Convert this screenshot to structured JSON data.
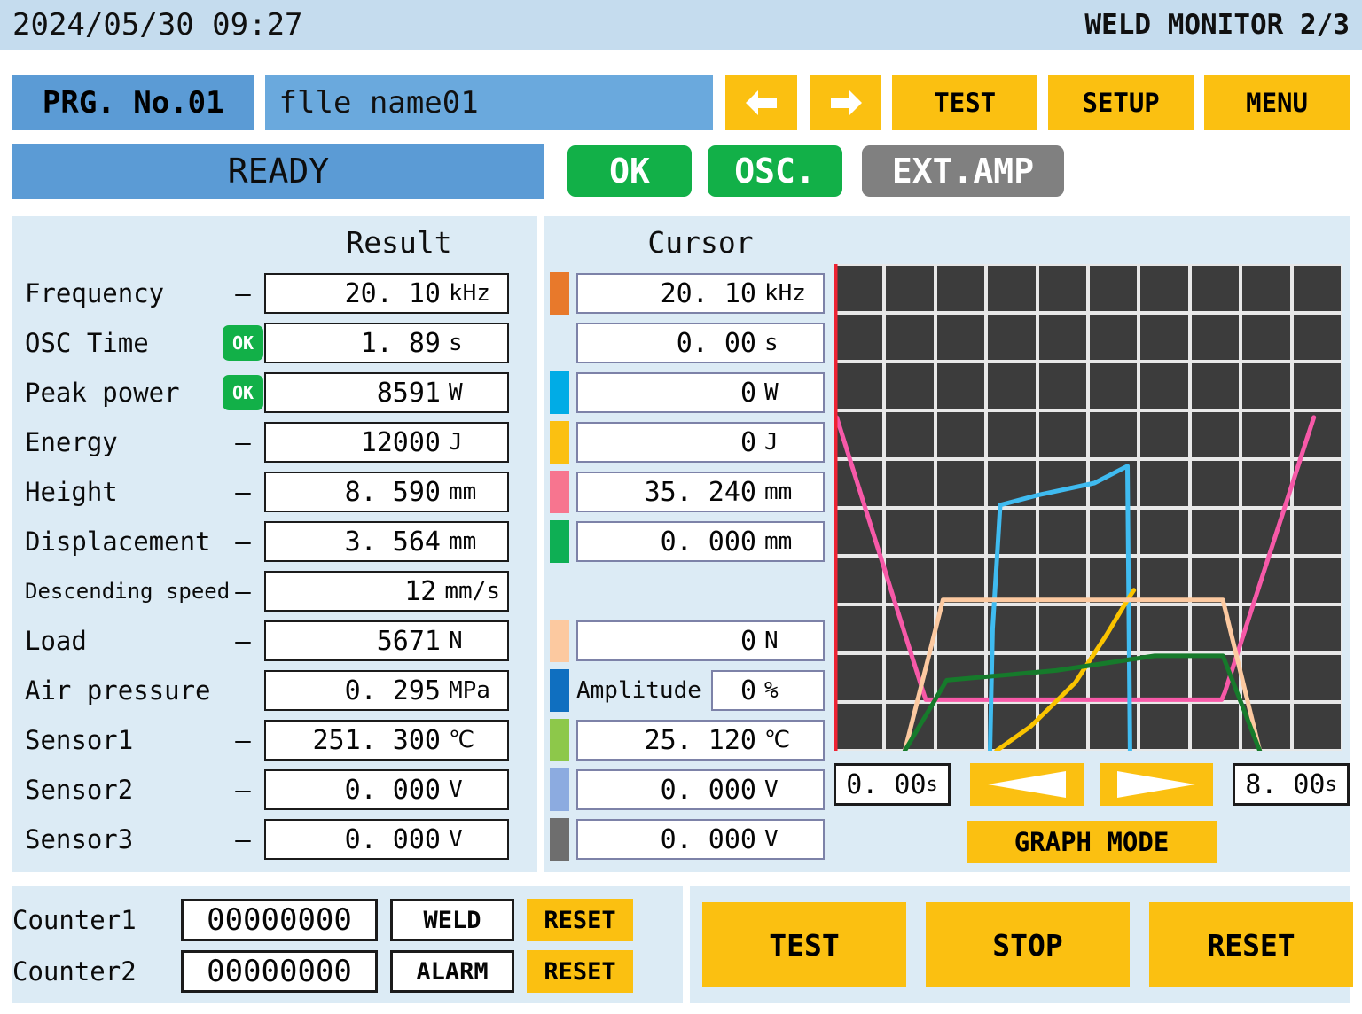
{
  "header": {
    "datetime": "2024/05/30 09:27",
    "page_title": "WELD MONITOR 2/3"
  },
  "program": {
    "prg_no": "PRG. No.01",
    "file_name": "flle name01",
    "prev_label": "◀",
    "next_label": "▶",
    "test_label": "TEST",
    "setup_label": "SETUP",
    "menu_label": "MENU"
  },
  "status": {
    "state": "READY",
    "ok_label": "OK",
    "osc_label": "OSC.",
    "ext_amp_label": "EXT.AMP"
  },
  "columns": {
    "result_header": "Result",
    "cursor_header": "Cursor"
  },
  "measurements": [
    {
      "label": "Frequency",
      "judge": "—",
      "result": "20. 10",
      "unit": "kHz",
      "swatch": "#e8792b",
      "cursor": "20. 10",
      "cursor_unit": "kHz"
    },
    {
      "label": "OSC Time",
      "judge": "OK",
      "result": "1. 89",
      "unit": "s",
      "swatch": null,
      "cursor": "0. 00",
      "cursor_unit": "s"
    },
    {
      "label": "Peak power",
      "judge": "OK",
      "result": "8591",
      "unit": "W",
      "swatch": "#00ace6",
      "cursor": "0",
      "cursor_unit": "W"
    },
    {
      "label": "Energy",
      "judge": "—",
      "result": "12000",
      "unit": "J",
      "swatch": "#fbc011",
      "cursor": "0",
      "cursor_unit": "J"
    },
    {
      "label": "Height",
      "judge": "—",
      "result": "8. 590",
      "unit": "mm",
      "swatch": "#f7758f",
      "cursor": "35. 240",
      "cursor_unit": "mm"
    },
    {
      "label": "Displacement",
      "judge": "—",
      "result": "3. 564",
      "unit": "mm",
      "swatch": "#0eaf54",
      "cursor": "0. 000",
      "cursor_unit": "mm"
    },
    {
      "label": "Descending speed",
      "judge": "—",
      "result": "12",
      "unit": "mm/s",
      "swatch": null,
      "cursor": null,
      "cursor_unit": null
    },
    {
      "label": "Load",
      "judge": "—",
      "result": "5671",
      "unit": "N",
      "swatch": "#fcc9a0",
      "cursor": "0",
      "cursor_unit": "N"
    },
    {
      "label": "Air pressure",
      "judge": "",
      "result": "0. 295",
      "unit": "MPa",
      "swatch": "#0f6fc0",
      "cursor": "0",
      "cursor_unit": "%",
      "cursor_label": "Amplitude"
    },
    {
      "label": "Sensor1",
      "judge": "—",
      "result": "251. 300",
      "unit": "℃",
      "swatch": "#8dc84a",
      "cursor": "25. 120",
      "cursor_unit": "℃"
    },
    {
      "label": "Sensor2",
      "judge": "—",
      "result": "0. 000",
      "unit": "V",
      "swatch": "#8cabe0",
      "cursor": "0. 000",
      "cursor_unit": "V"
    },
    {
      "label": "Sensor3",
      "judge": "—",
      "result": "0. 000",
      "unit": "V",
      "swatch": "#6e6e6e",
      "cursor": "0. 000",
      "cursor_unit": "V"
    }
  ],
  "graph_controls": {
    "time_start": "0. 00",
    "time_start_unit": "s",
    "time_end": "8. 00",
    "time_end_unit": "s",
    "scroll_left_label": "◀",
    "scroll_right_label": "▶",
    "graph_mode_label": "GRAPH MODE"
  },
  "counters": [
    {
      "name": "Counter1",
      "value": "00000000",
      "type": "WELD",
      "reset_label": "RESET"
    },
    {
      "name": "Counter2",
      "value": "00000000",
      "type": "ALARM",
      "reset_label": "RESET"
    }
  ],
  "actions": [
    {
      "label": "TEST"
    },
    {
      "label": "STOP"
    },
    {
      "label": "RESET"
    }
  ],
  "chart_data": {
    "type": "line",
    "title": "",
    "xlabel": "",
    "ylabel": "",
    "xlim": [
      0,
      8
    ],
    "ylim": [
      0,
      100
    ],
    "grid": true,
    "grid_cols": 10,
    "grid_rows": 10,
    "plot_background": "#3c3c3c",
    "grid_color": "#e8e8e8",
    "axis_color": "#ee2233",
    "legend": "none",
    "series": [
      {
        "name": "Height",
        "color": "#f759a8",
        "x": [
          0.05,
          1.4,
          1.45,
          6.1,
          6.15,
          7.55
        ],
        "y": [
          68.5,
          12.5,
          10.5,
          10.5,
          12.0,
          68.5
        ]
      },
      {
        "name": "Peak power",
        "color": "#3fbbf0",
        "x": [
          2.46,
          2.5,
          2.62,
          3.2,
          4.1,
          4.62,
          4.66
        ],
        "y": [
          0.0,
          25.0,
          50.5,
          52.5,
          55.0,
          58.5,
          0.0
        ]
      },
      {
        "name": "Energy",
        "color": "#fac400",
        "x": [
          2.56,
          3.1,
          3.8,
          4.3,
          4.62,
          4.72
        ],
        "y": [
          0.0,
          5.0,
          14.0,
          24.0,
          31.0,
          33.0
        ]
      },
      {
        "name": "Load",
        "color": "#fcc9a0",
        "x": [
          1.12,
          1.72,
          6.12,
          6.7
        ],
        "y": [
          0.0,
          31.0,
          31.0,
          0.0
        ]
      },
      {
        "name": "Displacement",
        "color": "#167a2b",
        "x": [
          1.12,
          1.78,
          3.5,
          5.05,
          6.12,
          6.7
        ],
        "y": [
          0.0,
          14.5,
          16.5,
          19.5,
          19.5,
          0.0
        ]
      }
    ]
  }
}
